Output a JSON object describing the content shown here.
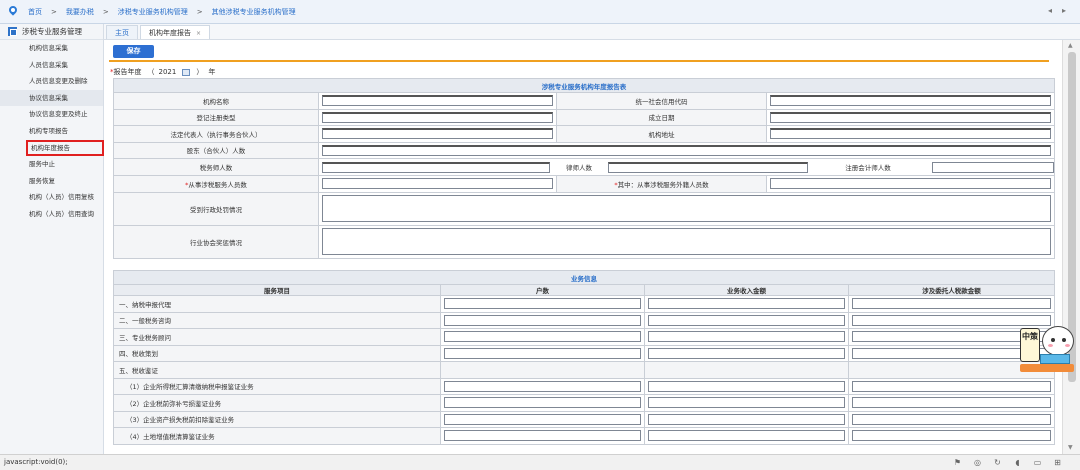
{
  "breadcrumb": [
    "首页",
    "我要办税",
    "涉税专业服务机构管理",
    "其他涉税专业服务机构管理"
  ],
  "breadcrumb_sep": ">",
  "sidebar": {
    "title": "涉税专业服务管理",
    "items": [
      {
        "label": "机构信息采集"
      },
      {
        "label": "人员信息采集"
      },
      {
        "label": "人员信息变更及删除"
      },
      {
        "label": "协议信息采集"
      },
      {
        "label": "协议信息变更及终止"
      },
      {
        "label": "机构专项报告"
      },
      {
        "label": "机构年度报告"
      },
      {
        "label": "服务中止"
      },
      {
        "label": "服务恢复"
      },
      {
        "label": "机构（人员）信用复核"
      },
      {
        "label": "机构（人员）信用查询"
      }
    ]
  },
  "tabs": [
    {
      "label": "主页"
    },
    {
      "label": "机构年度报告",
      "close": "×"
    }
  ],
  "toolbar": {
    "save_label": "保存"
  },
  "report_year": {
    "required_mark": "*",
    "label": "报告年度",
    "open": "（",
    "value": "2021",
    "close": "）",
    "suffix": "年"
  },
  "annual_report": {
    "caption": "涉税专业服务机构年度报告表",
    "org_name": "机构名称",
    "credit_code": "统一社会信用代码",
    "reg_type": "登记注册类型",
    "found_date": "成立日期",
    "legal_rep": "法定代表人（执行事务合伙人）",
    "address": "机构地址",
    "shareholders": "股东（合伙人）人数",
    "tax_agents": "税务师人数",
    "lawyers": "律师人数",
    "cpas": "注册会计师人数",
    "required_mark": "*",
    "staff": "从事涉税服务人员数",
    "staff_foreign": "其中：从事涉税服务外籍人员数",
    "penalty": "受到行政处罚情况",
    "awards": "行业协会奖惩情况"
  },
  "business": {
    "caption": "业务信息",
    "headers": [
      "服务项目",
      "户数",
      "业务收入金额",
      "涉及委托人税款金额"
    ],
    "rows": [
      {
        "label": "一、纳税申报代理",
        "inputs": true
      },
      {
        "label": "二、一般税务咨询",
        "inputs": true
      },
      {
        "label": "三、专业税务顾问",
        "inputs": true
      },
      {
        "label": "四、税收策划",
        "inputs": true
      },
      {
        "label": "五、税收鉴证",
        "inputs": false
      },
      {
        "label": "（1）企业所得税汇算清缴纳税申报鉴证业务",
        "inputs": true
      },
      {
        "label": "（2）企业税前弥补亏损鉴证业务",
        "inputs": true
      },
      {
        "label": "（3）企业资产损失税前扣除鉴证业务",
        "inputs": true
      },
      {
        "label": "（4）土地增值税清算鉴证业务",
        "inputs": true
      }
    ]
  },
  "mascot": {
    "label": "中策"
  },
  "statusbar": {
    "text": "javascript:void(0);"
  }
}
